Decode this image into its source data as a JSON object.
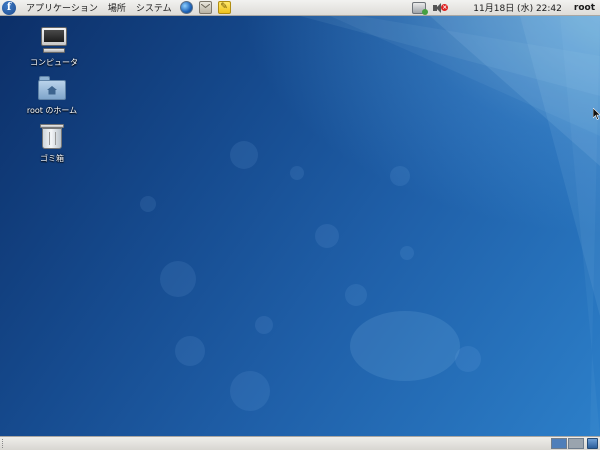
{
  "top_panel": {
    "logo_glyph": "f",
    "menus": [
      "アプリケーション",
      "場所",
      "システム"
    ],
    "launchers": [
      "web-browser-icon",
      "mail-client-icon",
      "notes-icon"
    ],
    "tray": [
      "network-icon",
      "volume-muted-icon"
    ],
    "clock": "11月18日 (水) 22:42",
    "user": "root"
  },
  "desktop": {
    "icons": [
      {
        "label": "コンピュータ",
        "icon": "computer-icon"
      },
      {
        "label": "root のホーム",
        "icon": "home-folder-icon"
      },
      {
        "label": "ゴミ箱",
        "icon": "trash-icon"
      }
    ]
  },
  "bottom_panel": {
    "workspaces": [
      "workspace-1",
      "workspace-2"
    ],
    "active_workspace": 1
  },
  "colors": {
    "panel": "#e6e4e0",
    "wallpaper_dark": "#0c2f68",
    "wallpaper_light": "#2c7fc9"
  }
}
